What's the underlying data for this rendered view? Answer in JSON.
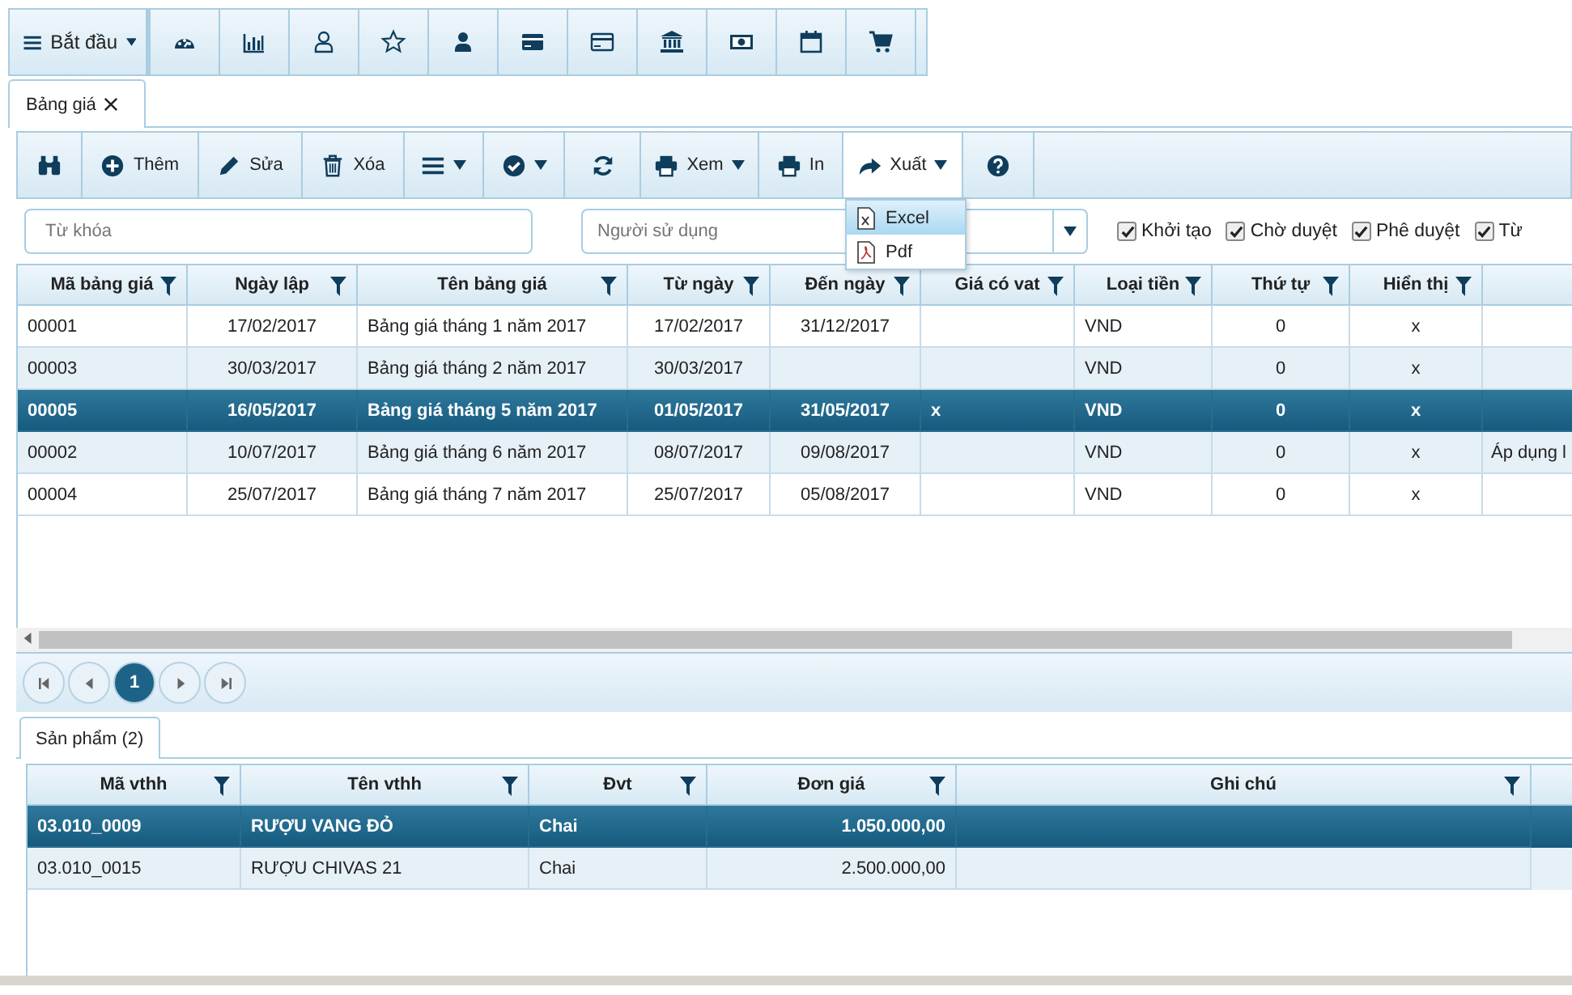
{
  "nav": {
    "start_label": "Bắt đầu"
  },
  "doc_tabs": [
    {
      "label": "Bảng giá",
      "selected": true
    }
  ],
  "toolbar": [
    {
      "kind": "search"
    },
    {
      "kind": "add",
      "label": "Thêm"
    },
    {
      "kind": "edit",
      "label": "Sửa"
    },
    {
      "kind": "delete",
      "label": "Xóa"
    },
    {
      "kind": "menu",
      "expanded": false
    },
    {
      "kind": "approve",
      "expanded": false
    },
    {
      "kind": "refresh"
    },
    {
      "kind": "preview",
      "label": "Xem",
      "expanded": false
    },
    {
      "kind": "print",
      "label": "In"
    },
    {
      "kind": "export",
      "label": "Xuất",
      "expanded": true
    },
    {
      "kind": "help"
    }
  ],
  "export_menu": [
    {
      "kind": "excel",
      "label": "Excel",
      "selected": true
    },
    {
      "kind": "pdf",
      "label": "Pdf",
      "selected": false
    }
  ],
  "filters": {
    "keyword": {
      "placeholder": "Từ khóa"
    },
    "user": {
      "placeholder": "Người sử dụng"
    },
    "statuses": [
      {
        "label": "Khởi tạo",
        "checked": true
      },
      {
        "label": "Chờ duyệt",
        "checked": true
      },
      {
        "label": "Phê duyệt",
        "checked": true
      },
      {
        "label": "Từ",
        "checked": true
      }
    ]
  },
  "table": {
    "columns": [
      "Mã bảng giá",
      "Ngày lập",
      "Tên bảng giá",
      "Từ ngày",
      "Đến ngày",
      "Giá có vat",
      "Loại tiền",
      "Thứ tự",
      "Hiển thị"
    ],
    "rows": [
      {
        "selected": false,
        "cells": [
          "00001",
          "17/02/2017",
          "Bảng giá tháng 1 năm 2017",
          "17/02/2017",
          "31/12/2017",
          "",
          "VND",
          "0",
          "x",
          ""
        ]
      },
      {
        "selected": false,
        "cells": [
          "00003",
          "30/03/2017",
          "Bảng giá tháng 2 năm 2017",
          "30/03/2017",
          "",
          "",
          "VND",
          "0",
          "x",
          ""
        ]
      },
      {
        "selected": true,
        "cells": [
          "00005",
          "16/05/2017",
          "Bảng giá tháng 5 năm 2017",
          "01/05/2017",
          "31/05/2017",
          "x",
          "VND",
          "0",
          "x",
          ""
        ]
      },
      {
        "selected": false,
        "cells": [
          "00002",
          "10/07/2017",
          "Bảng giá tháng 6 năm 2017",
          "08/07/2017",
          "09/08/2017",
          "",
          "VND",
          "0",
          "x",
          "Áp dụng l"
        ]
      },
      {
        "selected": false,
        "cells": [
          "00004",
          "25/07/2017",
          "Bảng giá tháng 7 năm 2017",
          "25/07/2017",
          "05/08/2017",
          "",
          "VND",
          "0",
          "x",
          ""
        ]
      }
    ]
  },
  "pager": {
    "pages": [
      {
        "label": "1",
        "selected": true
      }
    ]
  },
  "detail_tabs": [
    {
      "label": "Sản phẩm (2)",
      "selected": true
    }
  ],
  "detail_table": {
    "columns": [
      "Mã vthh",
      "Tên vthh",
      "Đvt",
      "Đơn giá",
      "Ghi chú"
    ],
    "rows": [
      {
        "selected": true,
        "cells": [
          "03.010_0009",
          "RƯỢU VANG ĐỎ",
          "Chai",
          "1.050.000,00",
          ""
        ]
      },
      {
        "selected": false,
        "cells": [
          "03.010_0015",
          "RƯỢU CHIVAS 21",
          "Chai",
          "2.500.000,00",
          ""
        ]
      }
    ]
  }
}
